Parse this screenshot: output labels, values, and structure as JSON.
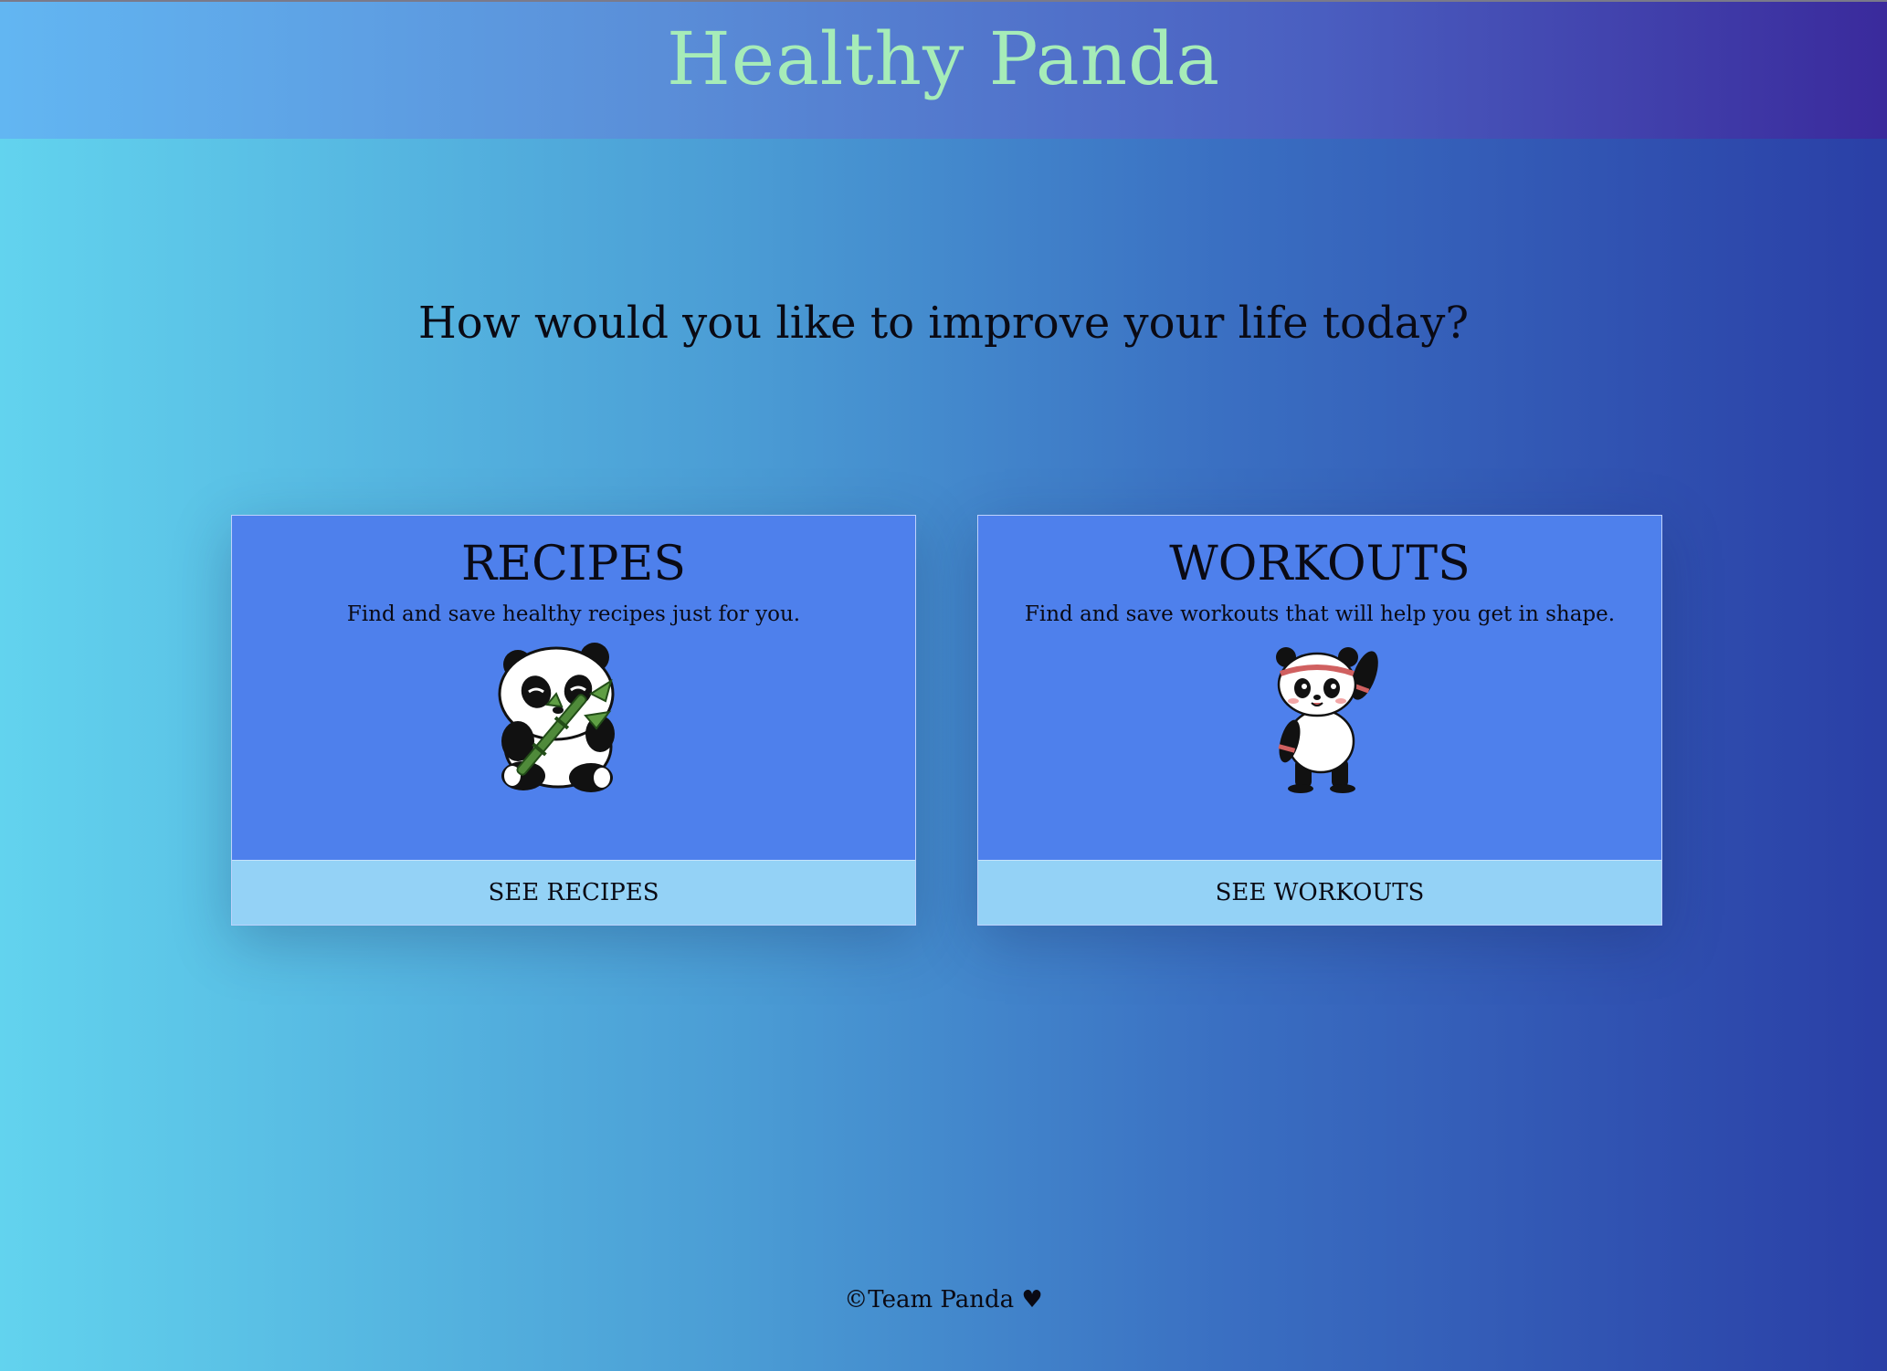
{
  "header": {
    "title": "Healthy Panda",
    "title_color": "#a6ecb8"
  },
  "main": {
    "tagline": "How would you like to improve your life today?"
  },
  "cards": [
    {
      "title": "RECIPES",
      "description": "Find and save healthy recipes just for you.",
      "illustration": "panda-eating-bamboo-icon",
      "button_label": "SEE RECIPES"
    },
    {
      "title": "WORKOUTS",
      "description": "Find and save workouts that will help you get in shape.",
      "illustration": "panda-waving-headband-icon",
      "button_label": "SEE WORKOUTS"
    }
  ],
  "colors": {
    "card_background": "#4e80ec",
    "button_background": "#94d2f6"
  },
  "footer": {
    "text": "©Team Panda ♥"
  }
}
